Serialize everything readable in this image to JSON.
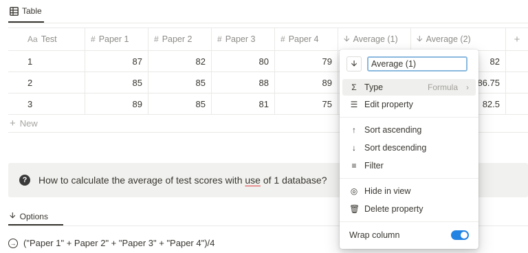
{
  "view_tab": {
    "label": "Table",
    "icon": "table-icon"
  },
  "table": {
    "columns": [
      {
        "label": "Test",
        "icon": "title-text-icon",
        "prefix": "Aa"
      },
      {
        "label": "Paper 1",
        "icon": "number-icon",
        "prefix": "#"
      },
      {
        "label": "Paper 2",
        "icon": "number-icon",
        "prefix": "#"
      },
      {
        "label": "Paper 3",
        "icon": "number-icon",
        "prefix": "#"
      },
      {
        "label": "Paper 4",
        "icon": "number-icon",
        "prefix": "#"
      },
      {
        "label": "Average (1)",
        "icon": "arrow-down-icon",
        "prefix": "🠗"
      },
      {
        "label": "Average (2)",
        "icon": "arrow-down-icon",
        "prefix": "🠗"
      }
    ],
    "add_column": "+",
    "rows": [
      {
        "test": "1",
        "p1": "87",
        "p2": "82",
        "p3": "80",
        "p4": "79",
        "avg2": "82"
      },
      {
        "test": "2",
        "p1": "85",
        "p2": "85",
        "p3": "88",
        "p4": "89",
        "avg2": "86.75"
      },
      {
        "test": "3",
        "p1": "89",
        "p2": "85",
        "p3": "81",
        "p4": "75",
        "avg2": "82.5"
      }
    ],
    "new_label": "New"
  },
  "callout": {
    "icon": "question-icon",
    "text_before": "How to calculate the average of test scores with ",
    "text_underlined": "use",
    "text_after": " of 1 database?"
  },
  "options_tab": {
    "label": "Options",
    "icon": "arrow-down-icon"
  },
  "formula_line": {
    "icon": "arrow-right-circle-icon",
    "text": "(\"Paper 1\" + Paper 2\" + \"Paper 3\" + \"Paper 4\")/4"
  },
  "property_menu": {
    "name_value": "Average (1)",
    "type_label": "Type",
    "type_value": "Formula",
    "edit_property": "Edit property",
    "sort_ascending": "Sort ascending",
    "sort_descending": "Sort descending",
    "filter": "Filter",
    "hide_in_view": "Hide in view",
    "delete_property": "Delete property",
    "wrap_column": "Wrap column",
    "wrap_enabled": true,
    "toggle_color": "#2383e2"
  }
}
